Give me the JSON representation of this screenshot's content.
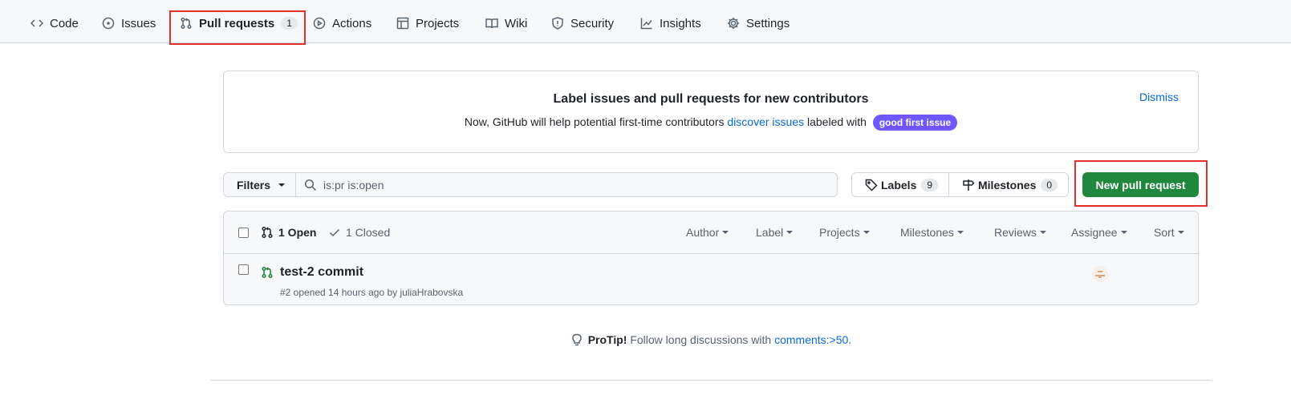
{
  "nav": {
    "tabs": [
      {
        "label": "Code",
        "icon": "code-icon"
      },
      {
        "label": "Issues",
        "icon": "issue-opened-icon"
      },
      {
        "label": "Pull requests",
        "icon": "git-pull-request-icon",
        "count": "1",
        "active": true
      },
      {
        "label": "Actions",
        "icon": "play-icon"
      },
      {
        "label": "Projects",
        "icon": "table-icon"
      },
      {
        "label": "Wiki",
        "icon": "book-icon"
      },
      {
        "label": "Security",
        "icon": "shield-icon"
      },
      {
        "label": "Insights",
        "icon": "graph-icon"
      },
      {
        "label": "Settings",
        "icon": "gear-icon"
      }
    ]
  },
  "banner": {
    "title": "Label issues and pull requests for new contributors",
    "text_before": "Now, GitHub will help potential first-time contributors",
    "link": "discover issues",
    "text_after": "labeled with",
    "label": "good first issue",
    "dismiss": "Dismiss"
  },
  "toolbar": {
    "filters": "Filters",
    "search_value": "is:pr is:open",
    "labels": "Labels",
    "labels_count": "9",
    "milestones": "Milestones",
    "milestones_count": "0",
    "new_pr": "New pull request"
  },
  "list": {
    "open": "1 Open",
    "closed": "1 Closed",
    "filters": [
      "Author",
      "Label",
      "Projects",
      "Milestones",
      "Reviews",
      "Assignee",
      "Sort"
    ],
    "items": [
      {
        "title": "test-2 commit",
        "meta": "#2 opened 14 hours ago by juliaHrabovska"
      }
    ]
  },
  "protip": {
    "label": "ProTip!",
    "text": "Follow long discussions with",
    "link": "comments:>50",
    "end": "."
  },
  "colors": {
    "highlight": "#e5302a",
    "primary_button": "#1f883d",
    "label_pill": "#7057ff",
    "link": "#0969da"
  }
}
